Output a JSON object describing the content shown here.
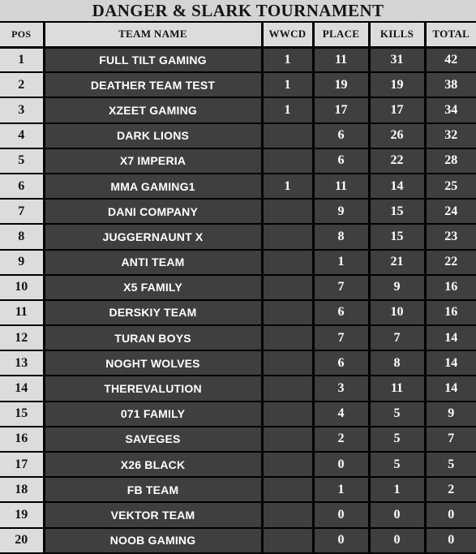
{
  "title": "DANGER & SLARK TOURNAMENT",
  "colors": {
    "title_bg": "#d4d4d4",
    "header_bg": "#dcdcdc",
    "row_dark_bg": "#3f3f3f",
    "grid_line": "#000000",
    "dark_text": "#121212",
    "light_text": "#ffffff"
  },
  "columns": [
    {
      "key": "pos",
      "label": "POS"
    },
    {
      "key": "team",
      "label": "TEAM NAME"
    },
    {
      "key": "wwcd",
      "label": "WWCD"
    },
    {
      "key": "place",
      "label": "PLACE"
    },
    {
      "key": "kills",
      "label": "KILLS"
    },
    {
      "key": "total",
      "label": "TOTAL"
    }
  ],
  "rows": [
    {
      "pos": "1",
      "team": "FULL TILT GAMING",
      "wwcd": "1",
      "place": "11",
      "kills": "31",
      "total": "42"
    },
    {
      "pos": "2",
      "team": "DEATHER TEAM TEST",
      "wwcd": "1",
      "place": "19",
      "kills": "19",
      "total": "38"
    },
    {
      "pos": "3",
      "team": "XZEET GAMING",
      "wwcd": "1",
      "place": "17",
      "kills": "17",
      "total": "34"
    },
    {
      "pos": "4",
      "team": "DARK LIONS",
      "wwcd": "",
      "place": "6",
      "kills": "26",
      "total": "32"
    },
    {
      "pos": "5",
      "team": "X7 IMPERIA",
      "wwcd": "",
      "place": "6",
      "kills": "22",
      "total": "28"
    },
    {
      "pos": "6",
      "team": "MMA GAMING1",
      "wwcd": "1",
      "place": "11",
      "kills": "14",
      "total": "25"
    },
    {
      "pos": "7",
      "team": "DANI COMPANY",
      "wwcd": "",
      "place": "9",
      "kills": "15",
      "total": "24"
    },
    {
      "pos": "8",
      "team": "JUGGERNAUNT X",
      "wwcd": "",
      "place": "8",
      "kills": "15",
      "total": "23"
    },
    {
      "pos": "9",
      "team": "ANTI TEAM",
      "wwcd": "",
      "place": "1",
      "kills": "21",
      "total": "22"
    },
    {
      "pos": "10",
      "team": "X5 FAMILY",
      "wwcd": "",
      "place": "7",
      "kills": "9",
      "total": "16"
    },
    {
      "pos": "11",
      "team": "DERSKIY TEAM",
      "wwcd": "",
      "place": "6",
      "kills": "10",
      "total": "16"
    },
    {
      "pos": "12",
      "team": "TURAN BOYS",
      "wwcd": "",
      "place": "7",
      "kills": "7",
      "total": "14"
    },
    {
      "pos": "13",
      "team": "NOGHT WOLVES",
      "wwcd": "",
      "place": "6",
      "kills": "8",
      "total": "14"
    },
    {
      "pos": "14",
      "team": "THEREVALUTION",
      "wwcd": "",
      "place": "3",
      "kills": "11",
      "total": "14"
    },
    {
      "pos": "15",
      "team": "071 FAMILY",
      "wwcd": "",
      "place": "4",
      "kills": "5",
      "total": "9"
    },
    {
      "pos": "16",
      "team": "SAVEGES",
      "wwcd": "",
      "place": "2",
      "kills": "5",
      "total": "7"
    },
    {
      "pos": "17",
      "team": "X26 BLACK",
      "wwcd": "",
      "place": "0",
      "kills": "5",
      "total": "5"
    },
    {
      "pos": "18",
      "team": "FB TEAM",
      "wwcd": "",
      "place": "1",
      "kills": "1",
      "total": "2"
    },
    {
      "pos": "19",
      "team": "VEKTOR TEAM",
      "wwcd": "",
      "place": "0",
      "kills": "0",
      "total": "0"
    },
    {
      "pos": "20",
      "team": "NOOB GAMING",
      "wwcd": "",
      "place": "0",
      "kills": "0",
      "total": "0"
    }
  ]
}
